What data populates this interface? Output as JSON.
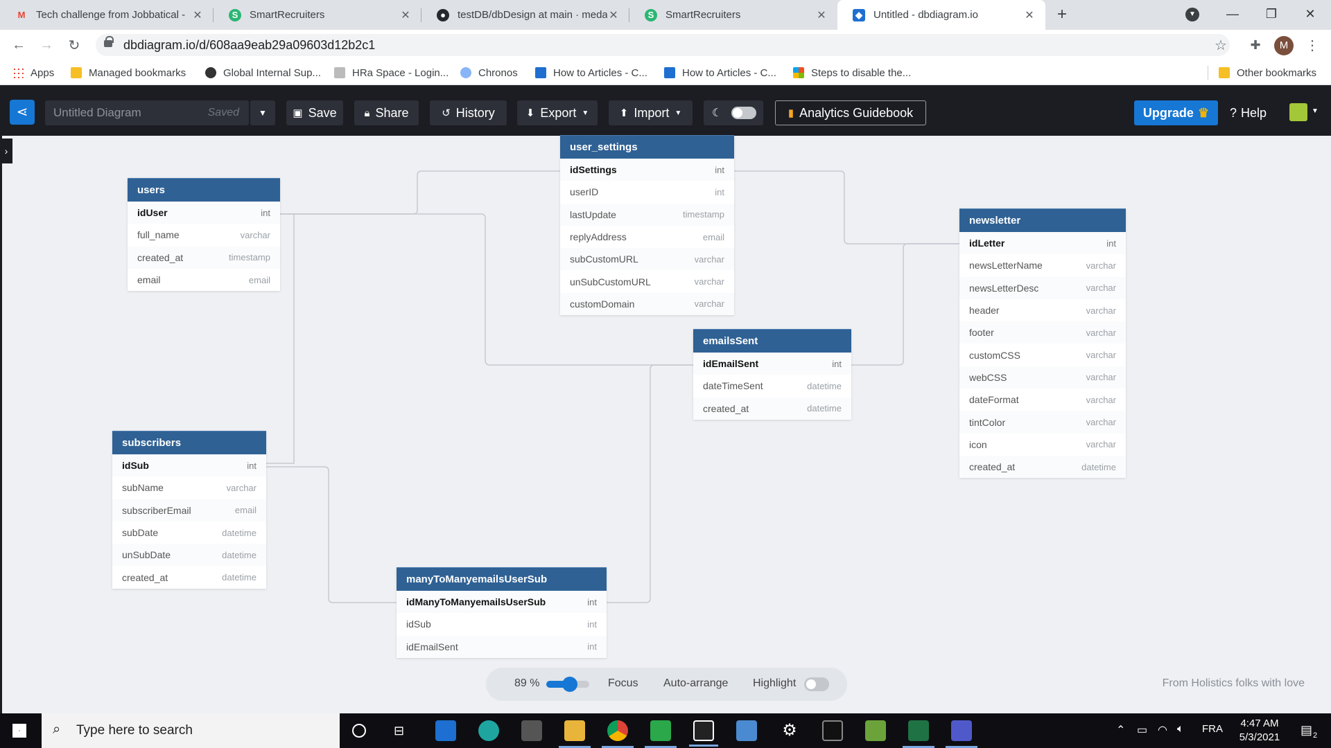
{
  "browser": {
    "tabs": [
      {
        "title": "Tech challenge from Jobbatical -",
        "icon": "gmail-icon",
        "color": "#ea4335",
        "glyph": "M"
      },
      {
        "title": "SmartRecruiters",
        "icon": "smartrecruiters-icon",
        "color": "#2bb673",
        "glyph": "S"
      },
      {
        "title": "testDB/dbDesign at main · medal",
        "icon": "github-icon",
        "color": "#24292e",
        "glyph": "●"
      },
      {
        "title": "SmartRecruiters",
        "icon": "smartrecruiters-icon",
        "color": "#2bb673",
        "glyph": "S"
      },
      {
        "title": "Untitled - dbdiagram.io",
        "icon": "dbdiagram-icon",
        "color": "#1f6fd1",
        "glyph": "◆"
      }
    ],
    "url": "dbdiagram.io/d/608aa9eab29a09603d12b2c1",
    "profile_initial": "M",
    "bookmarks": [
      {
        "label": "Apps",
        "icon": "apps-grid-icon"
      },
      {
        "label": "Managed bookmarks",
        "icon": "folder-icon"
      },
      {
        "label": "Global Internal Sup...",
        "icon": "bookmark-icon"
      },
      {
        "label": "HRa Space - Login...",
        "icon": "bookmark-icon"
      },
      {
        "label": "Chronos",
        "icon": "bookmark-icon"
      },
      {
        "label": "How to Articles - C...",
        "icon": "confluence-icon"
      },
      {
        "label": "How to Articles - C...",
        "icon": "confluence-icon"
      },
      {
        "label": "Steps to disable the...",
        "icon": "microsoft-icon"
      }
    ],
    "other_bookmarks": "Other bookmarks"
  },
  "toolbar": {
    "diagram_name": "Untitled Diagram",
    "saved_status": "Saved",
    "save": "Save",
    "share": "Share",
    "history": "History",
    "export": "Export",
    "import": "Import",
    "guidebook": "Analytics Guidebook",
    "upgrade": "Upgrade",
    "help": "Help"
  },
  "tables": {
    "users": {
      "name": "users",
      "fields": [
        [
          "idUser",
          "int"
        ],
        [
          "full_name",
          "varchar"
        ],
        [
          "created_at",
          "timestamp"
        ],
        [
          "email",
          "email"
        ]
      ]
    },
    "user_settings": {
      "name": "user_settings",
      "fields": [
        [
          "idSettings",
          "int"
        ],
        [
          "userID",
          "int"
        ],
        [
          "lastUpdate",
          "timestamp"
        ],
        [
          "replyAddress",
          "email"
        ],
        [
          "subCustomURL",
          "varchar"
        ],
        [
          "unSubCustomURL",
          "varchar"
        ],
        [
          "customDomain",
          "varchar"
        ]
      ]
    },
    "newsletter": {
      "name": "newsletter",
      "fields": [
        [
          "idLetter",
          "int"
        ],
        [
          "newsLetterName",
          "varchar"
        ],
        [
          "newsLetterDesc",
          "varchar"
        ],
        [
          "header",
          "varchar"
        ],
        [
          "footer",
          "varchar"
        ],
        [
          "customCSS",
          "varchar"
        ],
        [
          "webCSS",
          "varchar"
        ],
        [
          "dateFormat",
          "varchar"
        ],
        [
          "tintColor",
          "varchar"
        ],
        [
          "icon",
          "varchar"
        ],
        [
          "created_at",
          "datetime"
        ]
      ]
    },
    "emailsSent": {
      "name": "emailsSent",
      "fields": [
        [
          "idEmailSent",
          "int"
        ],
        [
          "dateTimeSent",
          "datetime"
        ],
        [
          "created_at",
          "datetime"
        ]
      ]
    },
    "subscribers": {
      "name": "subscribers",
      "fields": [
        [
          "idSub",
          "int"
        ],
        [
          "subName",
          "varchar"
        ],
        [
          "subscriberEmail",
          "email"
        ],
        [
          "subDate",
          "datetime"
        ],
        [
          "unSubDate",
          "datetime"
        ],
        [
          "created_at",
          "datetime"
        ]
      ]
    },
    "many": {
      "name": "manyToManyemailsUserSub",
      "fields": [
        [
          "idManyToManyemailsUserSub",
          "int"
        ],
        [
          "idSub",
          "int"
        ],
        [
          "idEmailSent",
          "int"
        ]
      ]
    }
  },
  "zoom": {
    "level": "89 %",
    "value": 0.48,
    "focus": "Focus",
    "auto_arrange": "Auto-arrange",
    "highlight": "Highlight"
  },
  "credit": "From Holistics folks with love",
  "taskbar": {
    "search_placeholder": "Type here to search",
    "language": "FRA",
    "time": "4:47 AM",
    "date": "5/3/2021",
    "notifications": "2"
  }
}
